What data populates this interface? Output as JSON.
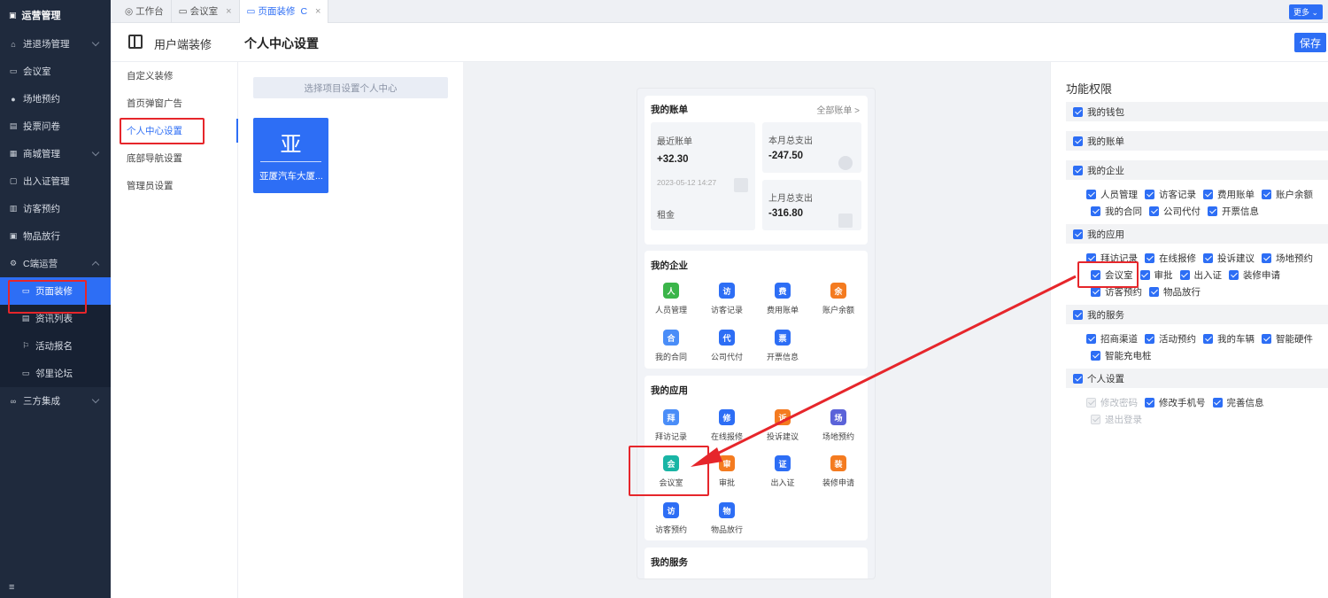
{
  "sidebar": {
    "brand": "运营管理",
    "items": [
      {
        "label": "进退场管理",
        "icon": "home-icon"
      },
      {
        "label": "会议室",
        "icon": "monitor-icon"
      },
      {
        "label": "场地预约",
        "icon": "user-icon"
      },
      {
        "label": "投票问卷",
        "icon": "file-icon"
      },
      {
        "label": "商城管理",
        "icon": "shop-icon"
      },
      {
        "label": "出入证管理",
        "icon": "card-icon"
      },
      {
        "label": "访客预约",
        "icon": "visitor-icon"
      },
      {
        "label": "物品放行",
        "icon": "box-icon"
      },
      {
        "label": "C端运营",
        "icon": "gear-icon"
      },
      {
        "label": "页面装修",
        "icon": "page-icon"
      },
      {
        "label": "资讯列表",
        "icon": "news-icon"
      },
      {
        "label": "活动报名",
        "icon": "flag-icon"
      },
      {
        "label": "邻里论坛",
        "icon": "chat-icon"
      },
      {
        "label": "三方集成",
        "icon": "link-icon"
      }
    ],
    "bottom_icon": "≡"
  },
  "tabs": [
    {
      "label": "工作台"
    },
    {
      "label": "会议室"
    },
    {
      "label": "页面装修"
    }
  ],
  "more_label": "更多",
  "header": {
    "left": "用户端装修",
    "title": "个人中心设置",
    "save": "保存"
  },
  "menu": [
    "自定义装修",
    "首页弹窗广告",
    "个人中心设置",
    "底部导航设置",
    "管理员设置"
  ],
  "project": {
    "select_placeholder": "选择项目设置个人中心",
    "card_char": "亚",
    "card_name": "亚厦汽车大厦..."
  },
  "phone": {
    "bill": {
      "title": "我的账单",
      "link": "全部账单 >",
      "recent_label": "最近账单",
      "recent_value": "+32.30",
      "recent_date": "2023-05-12 14:27",
      "recent_type": "租金",
      "month_label": "本月总支出",
      "month_value": "-247.50",
      "lastmonth_label": "上月总支出",
      "lastmonth_value": "-316.80"
    },
    "enterprise": {
      "title": "我的企业",
      "items": [
        {
          "label": "人员管理",
          "color": "#3bb54a",
          "glyph": "人"
        },
        {
          "label": "访客记录",
          "color": "#2d6ef5",
          "glyph": "访"
        },
        {
          "label": "费用账单",
          "color": "#2d6ef5",
          "glyph": "费"
        },
        {
          "label": "账户余额",
          "color": "#f47b20",
          "glyph": "余"
        },
        {
          "label": "我的合同",
          "color": "#4a8df8",
          "glyph": "合"
        },
        {
          "label": "公司代付",
          "color": "#2d6ef5",
          "glyph": "代"
        },
        {
          "label": "开票信息",
          "color": "#2d6ef5",
          "glyph": "票"
        }
      ]
    },
    "apps": {
      "title": "我的应用",
      "items": [
        {
          "label": "拜访记录",
          "color": "#4a8df8",
          "glyph": "拜"
        },
        {
          "label": "在线报修",
          "color": "#2d6ef5",
          "glyph": "修"
        },
        {
          "label": "投诉建议",
          "color": "#f47b20",
          "glyph": "诉"
        },
        {
          "label": "场地预约",
          "color": "#5b63d9",
          "glyph": "场"
        },
        {
          "label": "会议室",
          "color": "#19b5a5",
          "glyph": "会"
        },
        {
          "label": "审批",
          "color": "#f47b20",
          "glyph": "审"
        },
        {
          "label": "出入证",
          "color": "#2d6ef5",
          "glyph": "证"
        },
        {
          "label": "装修申请",
          "color": "#f47b20",
          "glyph": "装"
        },
        {
          "label": "访客预约",
          "color": "#2d6ef5",
          "glyph": "访"
        },
        {
          "label": "物品放行",
          "color": "#2d6ef5",
          "glyph": "物"
        }
      ]
    },
    "services_title": "我的服务"
  },
  "permissions": {
    "title": "功能权限",
    "groups": {
      "wallet": "我的钱包",
      "bill": "我的账单",
      "enterprise": "我的企业",
      "apps": "我的应用",
      "services": "我的服务",
      "personal": "个人设置"
    },
    "enterprise_opts": [
      "人员管理",
      "访客记录",
      "费用账单",
      "账户余额",
      "我的合同",
      "公司代付",
      "开票信息"
    ],
    "apps_opts": [
      "拜访记录",
      "在线报修",
      "投诉建议",
      "场地预约",
      "会议室",
      "审批",
      "出入证",
      "装修申请",
      "访客预约",
      "物品放行"
    ],
    "services_opts": [
      "招商渠道",
      "活动预约",
      "我的车辆",
      "智能硬件",
      "智能充电桩"
    ],
    "personal_opts": [
      "修改密码",
      "修改手机号",
      "完善信息",
      "退出登录"
    ]
  },
  "colors": {
    "accent": "#2d6ef5",
    "sidebar_bg": "#1f2a3d",
    "highlight": "#e6262b"
  }
}
